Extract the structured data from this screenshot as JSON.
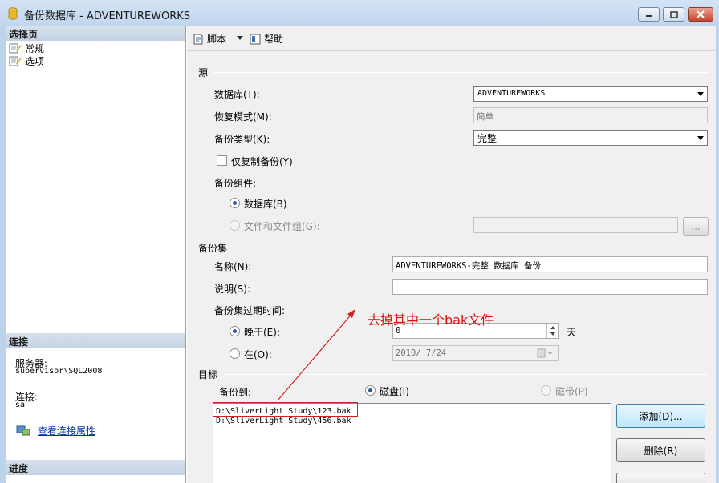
{
  "window": {
    "title": "备份数据库 - ADVENTUREWORKS"
  },
  "left_pane": {
    "select_page_header": "选择页",
    "pages": [
      {
        "label": "常规"
      },
      {
        "label": "选项"
      }
    ],
    "connection_header": "连接",
    "server_label": "服务器:",
    "server_value": "supervisor\\SQL2008",
    "connection_label": "连接:",
    "connection_value": "sa",
    "view_connection_link": "查看连接属性",
    "progress_header": "进度"
  },
  "toolbar": {
    "script_label": "脚本",
    "help_label": "帮助"
  },
  "source": {
    "group_title": "源",
    "database_label": "数据库(T):",
    "database_value": "ADVENTUREWORKS",
    "recovery_label": "恢复模式(M):",
    "recovery_value": "简单",
    "backup_type_label": "备份类型(K):",
    "backup_type_value": "完整",
    "copy_only_label": "仅复制备份(Y)",
    "component_label": "备份组件:",
    "component_database_label": "数据库(B)",
    "component_files_label": "文件和文件组(G):",
    "files_button": "..."
  },
  "backup_set": {
    "group_title": "备份集",
    "name_label": "名称(N):",
    "name_value": "ADVENTUREWORKS-完整 数据库 备份",
    "description_label": "说明(S):",
    "description_value": "",
    "expire_label": "备份集过期时间:",
    "after_label": "晚于(E):",
    "after_value": "0",
    "days_unit": "天",
    "on_label": "在(O):",
    "on_value": "2010/ 7/24"
  },
  "destination": {
    "group_title": "目标",
    "backup_to_label": "备份到:",
    "disk_label": "磁盘(I)",
    "tape_label": "磁带(P)",
    "files": [
      "D:\\SliverLight Study\\123.bak",
      "D:\\SliverLight Study\\456.bak"
    ],
    "add_button": "添加(D)...",
    "remove_button": "删除(R)"
  },
  "annotation": {
    "text": "去掉其中一个bak文件",
    "color": "#e01010"
  }
}
